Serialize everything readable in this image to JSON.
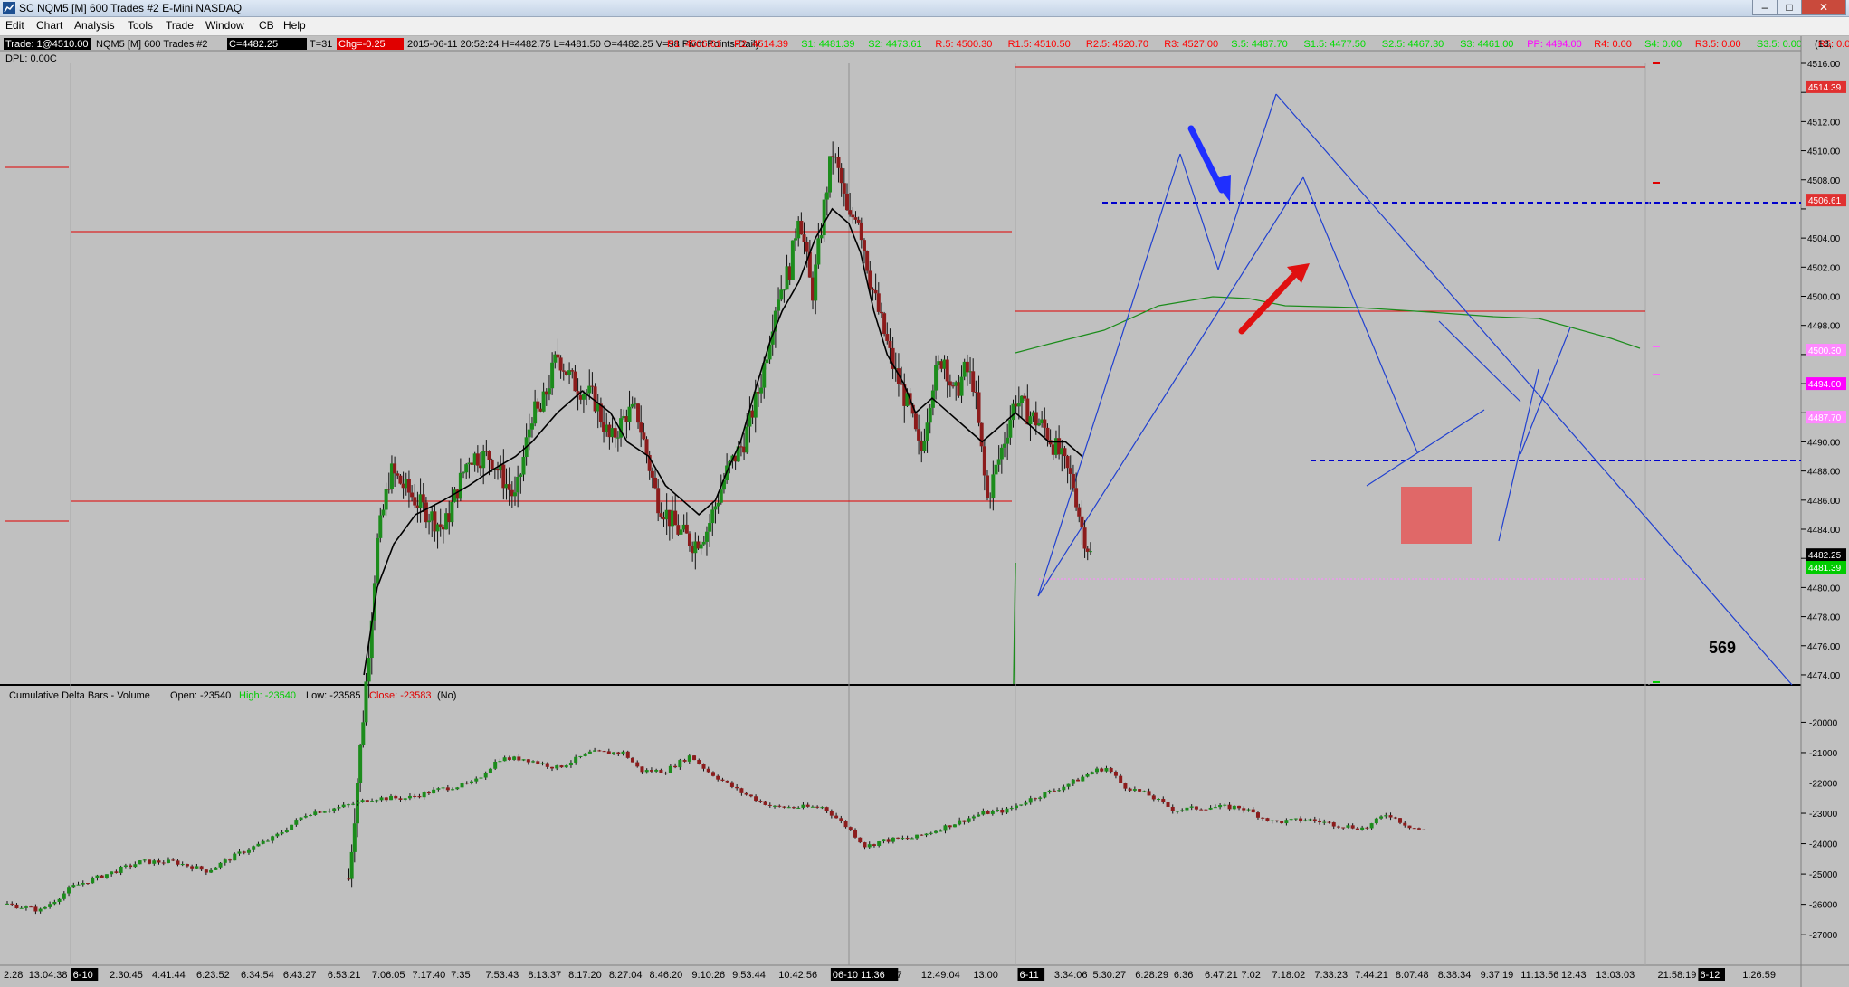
{
  "window": {
    "title": "SC NQM5 [M]  600 Trades  #2  E-Mini NASDAQ",
    "minimize": "–",
    "maximize": "□",
    "close": "✕"
  },
  "menu": [
    "Edit",
    "Chart",
    "Analysis",
    "Tools",
    "Trade",
    "Window",
    "CB",
    "Help"
  ],
  "header": {
    "trade_box": "Trade: 1@4510.00",
    "dpl": "DPL: 0.00C",
    "symbol": "NQM5 [M]  600 Trades  #2",
    "last_badge": "C=4482.25",
    "t_value": "T=31",
    "chg_badge": "Chg=-0.25",
    "ohlc": "2015-06-11  20:52:24  H=4482.75  L=4481.50  O=4482.25  V=58  Pivot Points-Daily",
    "right_edge": "(13,",
    "pivot_levels": [
      {
        "text": "R1: 4506.61",
        "color": "#ff0000"
      },
      {
        "text": "R2: 4514.39",
        "color": "#ff0000"
      },
      {
        "text": "S1: 4481.39",
        "color": "#00dd00"
      },
      {
        "text": "S2: 4473.61",
        "color": "#00dd00"
      },
      {
        "text": "R.5: 4500.30",
        "color": "#ff0000"
      },
      {
        "text": "R1.5: 4510.50",
        "color": "#ff0000"
      },
      {
        "text": "R2.5: 4520.70",
        "color": "#ff0000"
      },
      {
        "text": "R3: 4527.00",
        "color": "#ff0000"
      },
      {
        "text": "S.5: 4487.70",
        "color": "#00dd00"
      },
      {
        "text": "S1.5: 4477.50",
        "color": "#00dd00"
      },
      {
        "text": "S2.5: 4467.30",
        "color": "#00dd00"
      },
      {
        "text": "S3: 4461.00",
        "color": "#00dd00"
      },
      {
        "text": "PP: 4494.00",
        "color": "#ff00ff"
      },
      {
        "text": "R4: 0.00",
        "color": "#ff0000"
      },
      {
        "text": "S4: 0.00",
        "color": "#00dd00"
      },
      {
        "text": "R3.5: 0.00",
        "color": "#ff0000"
      },
      {
        "text": "S3.5: 0.00",
        "color": "#00dd00"
      },
      {
        "text": "R5: 0.00",
        "color": "#ff0000"
      },
      {
        "text": "S5: 0.00",
        "color": "#00dd00"
      }
    ]
  },
  "annotation_number": "569",
  "chart_data": {
    "type": "candlestick",
    "symbol": "NQM5",
    "colors": {
      "up": "#1c8c1c",
      "down": "#8c1c1c",
      "ma": "#000000",
      "trend": "#0000cc",
      "background": "#c0c0c0"
    },
    "price_axis": {
      "ticks": [
        4474,
        4476,
        4478,
        4480,
        4482,
        4484,
        4486,
        4488,
        4490,
        4492,
        4494,
        4496,
        4498,
        4500,
        4502,
        4504,
        4506,
        4508,
        4510,
        4512,
        4514,
        4516
      ],
      "range": [
        4473.5,
        4516.0
      ],
      "labels": [
        {
          "text": "4474.00",
          "value": 4474
        },
        {
          "text": "4476.00",
          "value": 4476
        },
        {
          "text": "4478.00",
          "value": 4478
        },
        {
          "text": "4480.00",
          "value": 4480
        },
        {
          "text": "4484.00",
          "value": 4484
        },
        {
          "text": "4486.00",
          "value": 4486
        },
        {
          "text": "4488.00",
          "value": 4488
        },
        {
          "text": "4490.00",
          "value": 4490
        },
        {
          "text": "4498.00",
          "value": 4498
        },
        {
          "text": "4500.00",
          "value": 4500
        },
        {
          "text": "4502.00",
          "value": 4502
        },
        {
          "text": "4504.00",
          "value": 4504
        },
        {
          "text": "4508.00",
          "value": 4508
        },
        {
          "text": "4510.00",
          "value": 4510
        },
        {
          "text": "4512.00",
          "value": 4512
        },
        {
          "text": "4516.00",
          "value": 4516
        }
      ],
      "markers": [
        {
          "text": "4514.39",
          "value": 4514.39,
          "bg": "#e03030",
          "fg": "#ffffff"
        },
        {
          "text": "4506.61",
          "value": 4506.61,
          "bg": "#e03030",
          "fg": "#ffffff"
        },
        {
          "text": "4500.30",
          "value": 4496.3,
          "bg": "#ff88ff",
          "fg": "#ffffff"
        },
        {
          "text": "4494.00",
          "value": 4494.0,
          "bg": "#ff00ff",
          "fg": "#ffffff"
        },
        {
          "text": "4487.70",
          "value": 4491.7,
          "bg": "#ff88ff",
          "fg": "#ffffff"
        },
        {
          "text": "4482.25",
          "value": 4482.25,
          "bg": "#000000",
          "fg": "#ffffff"
        },
        {
          "text": "4481.39",
          "value": 4481.39,
          "bg": "#00cc00",
          "fg": "#ffffff"
        }
      ]
    },
    "delta_panel": {
      "title": "Cumulative Delta Bars - Volume",
      "open": "Open: -23540",
      "high": "High: -23540",
      "low": "Low: -23585",
      "close": "Close: -23583",
      "suffix": "(No)",
      "ticks": [
        -20000,
        -21000,
        -22000,
        -23000,
        -24000,
        -25000,
        -26000,
        -27000
      ],
      "range": [
        -27800,
        -19600
      ],
      "tick_labels": [
        "-20000",
        "-21000",
        "-22000",
        "-23000",
        "-24000",
        "-25000",
        "-26000",
        "-27000"
      ]
    },
    "time_labels": [
      {
        "text": "2:28",
        "pos": 0.0
      },
      {
        "text": "13:04:38",
        "pos": 0.013
      },
      {
        "text": "6-10",
        "pos": 0.036,
        "highlight": true
      },
      {
        "text": "2:30:45",
        "pos": 0.055
      },
      {
        "text": "4:41:44",
        "pos": 0.077
      },
      {
        "text": "6:23:52",
        "pos": 0.1
      },
      {
        "text": "6:34:54",
        "pos": 0.123
      },
      {
        "text": "6:43:27",
        "pos": 0.145
      },
      {
        "text": "6:53:21",
        "pos": 0.168
      },
      {
        "text": "7:06:05",
        "pos": 0.191
      },
      {
        "text": "7:17:40",
        "pos": 0.212
      },
      {
        "text": "7:35",
        "pos": 0.232
      },
      {
        "text": "7:53:43",
        "pos": 0.25
      },
      {
        "text": "8:13:37",
        "pos": 0.272
      },
      {
        "text": "8:17:20",
        "pos": 0.293
      },
      {
        "text": "8:27:04",
        "pos": 0.314
      },
      {
        "text": "8:46:20",
        "pos": 0.335
      },
      {
        "text": "9:10:26",
        "pos": 0.357
      },
      {
        "text": "9:53:44",
        "pos": 0.378
      },
      {
        "text": "10:42:56",
        "pos": 0.402
      },
      {
        "text": "06-10 11:36",
        "pos": 0.43,
        "highlight": true
      },
      {
        "text": "7:37",
        "pos": 0.456
      },
      {
        "text": "12:49:04",
        "pos": 0.476
      },
      {
        "text": "13:00",
        "pos": 0.503
      },
      {
        "text": "6-11",
        "pos": 0.527,
        "highlight": true
      },
      {
        "text": "3:34:06",
        "pos": 0.545
      },
      {
        "text": "5:30:27",
        "pos": 0.565
      },
      {
        "text": "6:28:29",
        "pos": 0.587
      },
      {
        "text": "6:36",
        "pos": 0.607
      },
      {
        "text": "6:47:21",
        "pos": 0.623
      },
      {
        "text": "7:02",
        "pos": 0.642
      },
      {
        "text": "7:18:02",
        "pos": 0.658
      },
      {
        "text": "7:33:23",
        "pos": 0.68
      },
      {
        "text": "7:44:21",
        "pos": 0.701
      },
      {
        "text": "8:07:48",
        "pos": 0.722
      },
      {
        "text": "8:38:34",
        "pos": 0.744
      },
      {
        "text": "9:37:19",
        "pos": 0.766
      },
      {
        "text": "11:13:56",
        "pos": 0.787
      },
      {
        "text": "12:43",
        "pos": 0.808
      },
      {
        "text": "13:03:03",
        "pos": 0.826
      },
      {
        "text": "21:58:19",
        "pos": 0.858
      },
      {
        "text": "6-12",
        "pos": 0.88,
        "highlight": true
      },
      {
        "text": "1:26:59",
        "pos": 0.902
      }
    ],
    "price_path": [
      [
        0.205,
        4460
      ],
      [
        0.215,
        4473
      ],
      [
        0.222,
        4483
      ],
      [
        0.23,
        4488
      ],
      [
        0.245,
        4486
      ],
      [
        0.262,
        4484
      ],
      [
        0.277,
        4489
      ],
      [
        0.29,
        4489
      ],
      [
        0.305,
        4486
      ],
      [
        0.315,
        4492
      ],
      [
        0.32,
        4492
      ],
      [
        0.33,
        4496
      ],
      [
        0.34,
        4494
      ],
      [
        0.352,
        4493
      ],
      [
        0.362,
        4490
      ],
      [
        0.372,
        4492
      ],
      [
        0.378,
        4492
      ],
      [
        0.39,
        4486
      ],
      [
        0.402,
        4484
      ],
      [
        0.412,
        4483
      ],
      [
        0.42,
        4484
      ],
      [
        0.426,
        4486
      ],
      [
        0.432,
        4488
      ],
      [
        0.442,
        4490
      ],
      [
        0.452,
        4494
      ],
      [
        0.462,
        4500
      ],
      [
        0.47,
        4502
      ],
      [
        0.475,
        4506
      ],
      [
        0.483,
        4500
      ],
      [
        0.49,
        4506
      ],
      [
        0.495,
        4510
      ],
      [
        0.5,
        4508
      ],
      [
        0.505,
        4505
      ],
      [
        0.51,
        4506
      ],
      [
        0.518,
        4501
      ],
      [
        0.525,
        4498
      ],
      [
        0.532,
        4495
      ],
      [
        0.542,
        4492
      ],
      [
        0.548,
        4489
      ],
      [
        0.555,
        4494
      ],
      [
        0.562,
        4496
      ],
      [
        0.568,
        4493
      ],
      [
        0.575,
        4495
      ],
      [
        0.58,
        4494
      ],
      [
        0.588,
        4486
      ],
      [
        0.598,
        4490
      ],
      [
        0.605,
        4493
      ],
      [
        0.612,
        4492
      ],
      [
        0.622,
        4491
      ],
      [
        0.632,
        4489
      ],
      [
        0.64,
        4487
      ],
      [
        0.645,
        4484
      ],
      [
        0.65,
        4482.25
      ]
    ],
    "ma_path": [
      [
        0.214,
        4474
      ],
      [
        0.222,
        4480
      ],
      [
        0.232,
        4483
      ],
      [
        0.245,
        4485
      ],
      [
        0.262,
        4486
      ],
      [
        0.277,
        4487
      ],
      [
        0.29,
        4488
      ],
      [
        0.305,
        4489
      ],
      [
        0.315,
        4490
      ],
      [
        0.33,
        4492
      ],
      [
        0.345,
        4493.5
      ],
      [
        0.362,
        4492
      ],
      [
        0.372,
        4490
      ],
      [
        0.385,
        4489
      ],
      [
        0.395,
        4487
      ],
      [
        0.405,
        4486
      ],
      [
        0.415,
        4485
      ],
      [
        0.425,
        4486
      ],
      [
        0.432,
        4488
      ],
      [
        0.44,
        4490
      ],
      [
        0.45,
        4494
      ],
      [
        0.458,
        4497
      ],
      [
        0.465,
        4499
      ],
      [
        0.475,
        4501
      ],
      [
        0.485,
        4504
      ],
      [
        0.495,
        4506
      ],
      [
        0.505,
        4505
      ],
      [
        0.512,
        4503
      ],
      [
        0.52,
        4499
      ],
      [
        0.528,
        4496
      ],
      [
        0.538,
        4494
      ],
      [
        0.545,
        4492
      ],
      [
        0.555,
        4493
      ],
      [
        0.565,
        4492
      ],
      [
        0.575,
        4491
      ],
      [
        0.585,
        4490
      ],
      [
        0.595,
        4491
      ],
      [
        0.605,
        4492
      ],
      [
        0.615,
        4491
      ],
      [
        0.625,
        4490
      ],
      [
        0.635,
        4490
      ],
      [
        0.645,
        4489
      ]
    ],
    "delta_path": [
      [
        0.0,
        -26000
      ],
      [
        0.02,
        -26200
      ],
      [
        0.04,
        -25400
      ],
      [
        0.06,
        -25000
      ],
      [
        0.08,
        -24600
      ],
      [
        0.1,
        -24600
      ],
      [
        0.12,
        -24900
      ],
      [
        0.14,
        -24300
      ],
      [
        0.16,
        -23800
      ],
      [
        0.18,
        -23000
      ],
      [
        0.2,
        -22800
      ],
      [
        0.22,
        -22500
      ],
      [
        0.24,
        -22500
      ],
      [
        0.26,
        -22200
      ],
      [
        0.28,
        -22000
      ],
      [
        0.295,
        -21200
      ],
      [
        0.31,
        -21200
      ],
      [
        0.33,
        -21500
      ],
      [
        0.35,
        -21000
      ],
      [
        0.37,
        -21000
      ],
      [
        0.38,
        -21600
      ],
      [
        0.395,
        -21600
      ],
      [
        0.41,
        -21100
      ],
      [
        0.42,
        -21600
      ],
      [
        0.44,
        -22300
      ],
      [
        0.46,
        -22800
      ],
      [
        0.475,
        -22800
      ],
      [
        0.49,
        -22800
      ],
      [
        0.505,
        -23500
      ],
      [
        0.515,
        -24100
      ],
      [
        0.525,
        -23900
      ],
      [
        0.545,
        -23800
      ],
      [
        0.565,
        -23400
      ],
      [
        0.585,
        -23000
      ],
      [
        0.6,
        -22900
      ],
      [
        0.615,
        -22500
      ],
      [
        0.63,
        -22200
      ],
      [
        0.642,
        -21900
      ],
      [
        0.652,
        -21600
      ],
      [
        0.66,
        -21500
      ],
      [
        0.67,
        -22100
      ],
      [
        0.685,
        -22400
      ],
      [
        0.7,
        -22900
      ],
      [
        0.72,
        -22800
      ],
      [
        0.74,
        -22800
      ],
      [
        0.76,
        -23300
      ],
      [
        0.78,
        -23200
      ],
      [
        0.8,
        -23400
      ],
      [
        0.815,
        -23500
      ],
      [
        0.828,
        -23000
      ],
      [
        0.84,
        -23400
      ],
      [
        0.85,
        -23583
      ]
    ]
  }
}
